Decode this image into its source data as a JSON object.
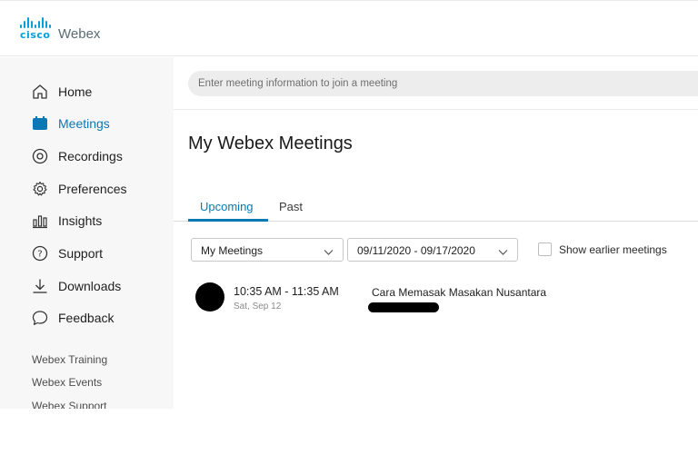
{
  "header": {
    "brand": "cisco",
    "product": "Webex",
    "accent_color": "#049fd9"
  },
  "sidebar": {
    "items": [
      {
        "label": "Home",
        "icon": "home-icon"
      },
      {
        "label": "Meetings",
        "icon": "calendar-icon",
        "active": true
      },
      {
        "label": "Recordings",
        "icon": "recording-icon"
      },
      {
        "label": "Preferences",
        "icon": "gear-icon"
      },
      {
        "label": "Insights",
        "icon": "bar-chart-icon"
      },
      {
        "label": "Support",
        "icon": "help-icon"
      },
      {
        "label": "Downloads",
        "icon": "download-icon"
      },
      {
        "label": "Feedback",
        "icon": "chat-bubble-icon"
      }
    ],
    "links": [
      "Webex Training",
      "Webex Events",
      "Webex Support"
    ],
    "active_color": "#0a78b5"
  },
  "search": {
    "placeholder": "Enter meeting information to join a meeting",
    "value": ""
  },
  "main": {
    "title": "My Webex Meetings",
    "tabs": [
      {
        "label": "Upcoming",
        "active": true
      },
      {
        "label": "Past",
        "active": false
      }
    ],
    "filter": {
      "scope": "My Meetings",
      "date_range": "09/11/2020 - 09/17/2020",
      "show_earlier_label": "Show earlier meetings",
      "show_earlier_checked": false
    },
    "meetings": [
      {
        "time": "10:35 AM - 11:35 AM",
        "date": "Sat, Sep 12",
        "title": "Cara Memasak Masakan Nusantara"
      }
    ]
  }
}
